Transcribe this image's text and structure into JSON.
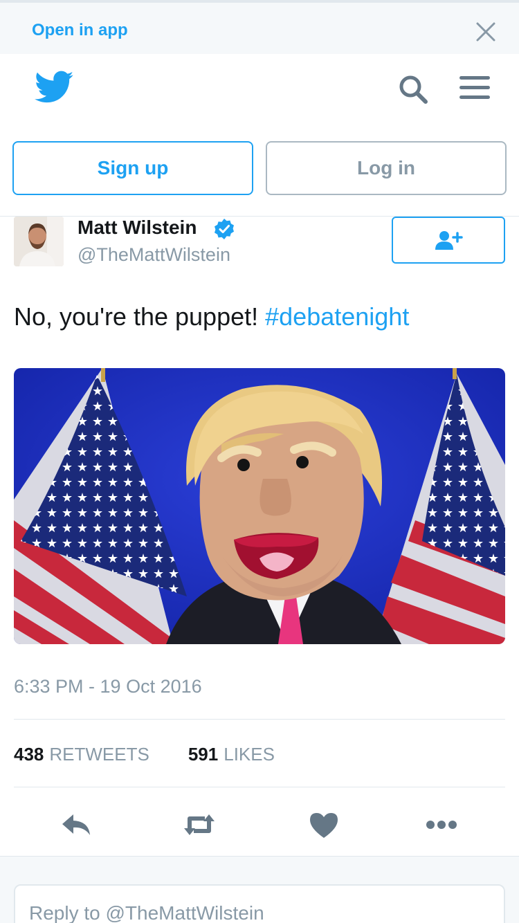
{
  "banner": {
    "open_in_app": "Open in app"
  },
  "auth": {
    "sign_up": "Sign up",
    "log_in": "Log in"
  },
  "tweet": {
    "author_name": "Matt Wilstein",
    "author_handle": "@TheMattWilstein",
    "text": "No, you're the puppet! ",
    "hashtag": "#debatenight",
    "timestamp": "6:33 PM - 19 Oct 2016",
    "retweets_count": "438",
    "retweets_label": "RETWEETS",
    "likes_count": "591",
    "likes_label": "LIKES"
  },
  "reply": {
    "placeholder": "Reply to @TheMattWilstein"
  },
  "colors": {
    "accent": "#1da1f2",
    "muted": "#8899a6",
    "border": "#e1e8ed",
    "icon": "#657786"
  },
  "icons": [
    "close-icon",
    "twitter-bird-icon",
    "search-icon",
    "menu-icon",
    "verified-icon",
    "follow-icon",
    "reply-icon",
    "retweet-icon",
    "heart-icon",
    "more-icon"
  ]
}
